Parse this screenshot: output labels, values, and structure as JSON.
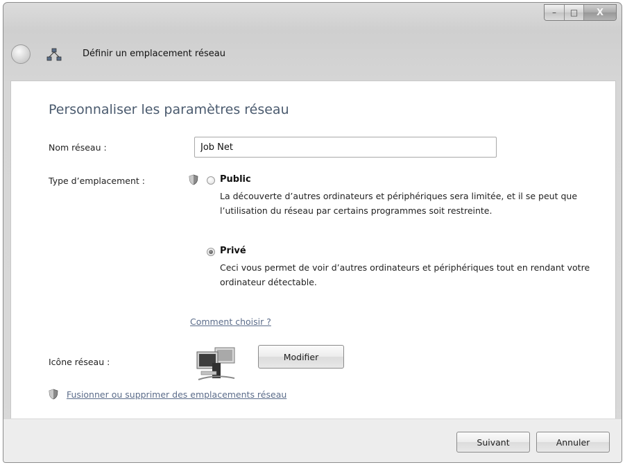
{
  "window": {
    "controls": {
      "minimize": "–",
      "maximize": "□",
      "close": "X"
    }
  },
  "nav": {
    "title": "Définir un emplacement réseau",
    "icon": "network-icon"
  },
  "main": {
    "heading": "Personnaliser les paramètres réseau",
    "network_name": {
      "label": "Nom réseau :",
      "value": "Job Net"
    },
    "location_type": {
      "label": "Type d’emplacement :",
      "options": [
        {
          "title": "Public",
          "description": "La découverte d’autres ordinateurs et périphériques sera limitée, et il se peut que l’utilisation du réseau par certains programmes soit restreinte.",
          "selected": false
        },
        {
          "title": "Privé",
          "description": "Ceci vous permet de voir d’autres ordinateurs et périphériques tout en rendant votre ordinateur détectable.",
          "selected": true
        }
      ],
      "help_link": "Comment choisir ?"
    },
    "network_icon": {
      "label": "Icône réseau :",
      "modify_label": "Modifier"
    },
    "merge_link": "Fusionner ou supprimer des emplacements réseau"
  },
  "footer": {
    "next_label": "Suivant",
    "cancel_label": "Annuler"
  }
}
